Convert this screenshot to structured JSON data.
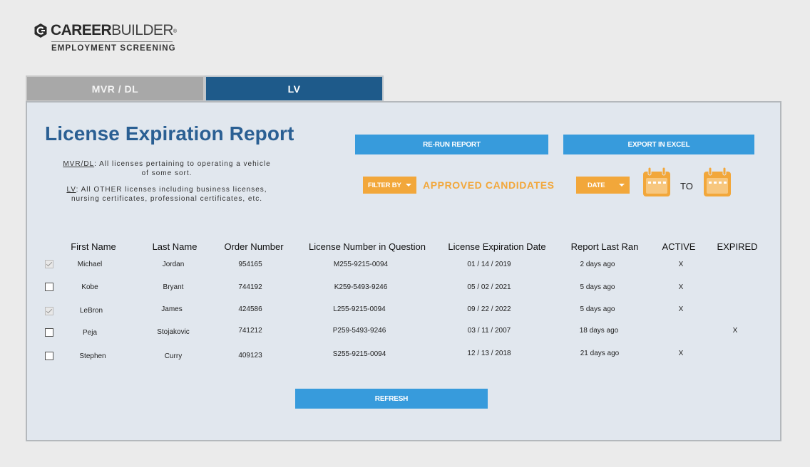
{
  "brand": {
    "name_bold": "CAREER",
    "name_light": "BUILDER",
    "trademark": "®",
    "subtitle": "EMPLOYMENT SCREENING"
  },
  "tabs": [
    {
      "label": "MVR / DL",
      "active": false
    },
    {
      "label": "LV",
      "active": true
    }
  ],
  "report": {
    "title": "License Expiration Report",
    "note_mvr_term": "MVR/DL",
    "note_mvr_text": ": All licenses pertaining to operating a vehicle of some sort.",
    "note_lv_term": "LV",
    "note_lv_text": ": All OTHER licenses including business licenses, nursing certificates, professional certificates, etc."
  },
  "actions": {
    "rerun_label": "RE-RUN REPORT",
    "export_label": "EXPORT IN EXCEL",
    "refresh_label": "REFRESH"
  },
  "filters": {
    "filter_by_label": "FILTER BY",
    "filter_value": "APPROVED CANDIDATES",
    "date_label": "DATE",
    "to_label": "TO"
  },
  "table": {
    "headers": {
      "first": "First Name",
      "last": "Last Name",
      "order": "Order Number",
      "license": "License Number in Question",
      "expiration": "License Expiration Date",
      "last_ran": "Report Last Ran",
      "active": "ACTIVE",
      "expired": "EXPIRED"
    },
    "rows": [
      {
        "first": "Michael",
        "last": "Jordan",
        "order": "954165",
        "license": "M255-9215-0094",
        "expiration": "01 / 14 / 2019",
        "last_ran": "2 days ago",
        "active": "X",
        "expired": "",
        "checked": true
      },
      {
        "first": "Kobe",
        "last": "Bryant",
        "order": "744192",
        "license": "K259-5493-9246",
        "expiration": "05 / 02 / 2021",
        "last_ran": "5 days ago",
        "active": "X",
        "expired": "",
        "checked": false
      },
      {
        "first": "LeBron",
        "last": "James",
        "order": "424586",
        "license": "L255-9215-0094",
        "expiration": "09 / 22 / 2022",
        "last_ran": "5 days ago",
        "active": "X",
        "expired": "",
        "checked": true
      },
      {
        "first": "Peja",
        "last": "Stojakovic",
        "order": "741212",
        "license": "P259-5493-9246",
        "expiration": "03 / 11 / 2007",
        "last_ran": "18 days ago",
        "active": "",
        "expired": "X",
        "checked": false
      },
      {
        "first": "Stephen",
        "last": "Curry",
        "order": "409123",
        "license": "S255-9215-0094",
        "expiration": "12 / 13 / 2018",
        "last_ran": "21 days ago",
        "active": "X",
        "expired": "",
        "checked": false
      }
    ]
  },
  "colors": {
    "primary_blue": "#1e5a8a",
    "button_blue": "#379bdc",
    "accent_orange": "#f2a73a"
  },
  "icons": {
    "logo": "careerbuilder-logo-icon",
    "calendar": "calendar-icon",
    "dropdown": "chevron-down-icon"
  }
}
